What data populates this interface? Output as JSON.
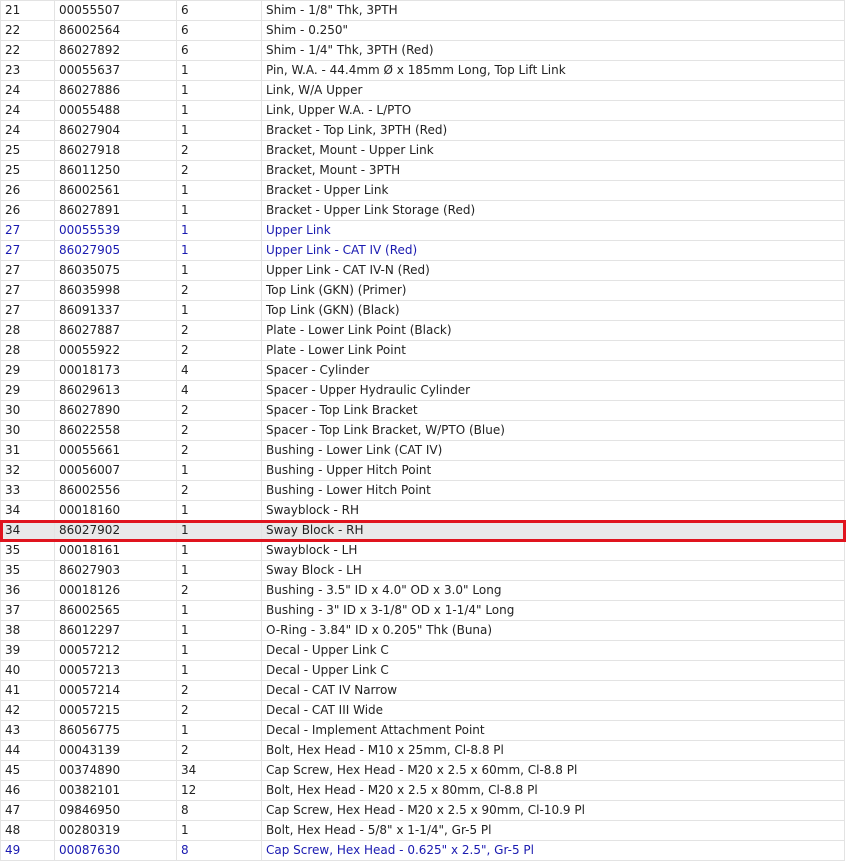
{
  "table": {
    "rows": [
      {
        "item": "21",
        "part": "00055507",
        "qty": "6",
        "desc": "Shim - 1/8\" Thk, 3PTH",
        "link": false,
        "hl": false
      },
      {
        "item": "22",
        "part": "86002564",
        "qty": "6",
        "desc": "Shim - 0.250\"",
        "link": false,
        "hl": false
      },
      {
        "item": "22",
        "part": "86027892",
        "qty": "6",
        "desc": "Shim - 1/4\" Thk, 3PTH (Red)",
        "link": false,
        "hl": false
      },
      {
        "item": "23",
        "part": "00055637",
        "qty": "1",
        "desc": "Pin, W.A. - 44.4mm Ø x 185mm Long, Top Lift Link",
        "link": false,
        "hl": false
      },
      {
        "item": "24",
        "part": "86027886",
        "qty": "1",
        "desc": "Link, W/A Upper",
        "link": false,
        "hl": false
      },
      {
        "item": "24",
        "part": "00055488",
        "qty": "1",
        "desc": "Link, Upper W.A. - L/PTO",
        "link": false,
        "hl": false
      },
      {
        "item": "24",
        "part": "86027904",
        "qty": "1",
        "desc": "Bracket - Top Link, 3PTH (Red)",
        "link": false,
        "hl": false
      },
      {
        "item": "25",
        "part": "86027918",
        "qty": "2",
        "desc": "Bracket, Mount - Upper Link",
        "link": false,
        "hl": false
      },
      {
        "item": "25",
        "part": "86011250",
        "qty": "2",
        "desc": "Bracket, Mount - 3PTH",
        "link": false,
        "hl": false
      },
      {
        "item": "26",
        "part": "86002561",
        "qty": "1",
        "desc": "Bracket - Upper Link",
        "link": false,
        "hl": false
      },
      {
        "item": "26",
        "part": "86027891",
        "qty": "1",
        "desc": "Bracket - Upper Link Storage (Red)",
        "link": false,
        "hl": false
      },
      {
        "item": "27",
        "part": "00055539",
        "qty": "1",
        "desc": "Upper Link",
        "link": true,
        "hl": false
      },
      {
        "item": "27",
        "part": "86027905",
        "qty": "1",
        "desc": "Upper Link - CAT IV (Red)",
        "link": true,
        "hl": false
      },
      {
        "item": "27",
        "part": "86035075",
        "qty": "1",
        "desc": "Upper Link - CAT IV-N (Red)",
        "link": false,
        "hl": false
      },
      {
        "item": "27",
        "part": "86035998",
        "qty": "2",
        "desc": "Top Link (GKN) (Primer)",
        "link": false,
        "hl": false
      },
      {
        "item": "27",
        "part": "86091337",
        "qty": "1",
        "desc": "Top Link (GKN) (Black)",
        "link": false,
        "hl": false
      },
      {
        "item": "28",
        "part": "86027887",
        "qty": "2",
        "desc": "Plate - Lower Link Point (Black)",
        "link": false,
        "hl": false
      },
      {
        "item": "28",
        "part": "00055922",
        "qty": "2",
        "desc": "Plate - Lower Link Point",
        "link": false,
        "hl": false
      },
      {
        "item": "29",
        "part": "00018173",
        "qty": "4",
        "desc": "Spacer - Cylinder",
        "link": false,
        "hl": false
      },
      {
        "item": "29",
        "part": "86029613",
        "qty": "4",
        "desc": "Spacer - Upper Hydraulic Cylinder",
        "link": false,
        "hl": false
      },
      {
        "item": "30",
        "part": "86027890",
        "qty": "2",
        "desc": "Spacer - Top Link Bracket",
        "link": false,
        "hl": false
      },
      {
        "item": "30",
        "part": "86022558",
        "qty": "2",
        "desc": "Spacer - Top Link Bracket, W/PTO (Blue)",
        "link": false,
        "hl": false
      },
      {
        "item": "31",
        "part": "00055661",
        "qty": "2",
        "desc": "Bushing - Lower Link (CAT IV)",
        "link": false,
        "hl": false
      },
      {
        "item": "32",
        "part": "00056007",
        "qty": "1",
        "desc": "Bushing - Upper Hitch Point",
        "link": false,
        "hl": false
      },
      {
        "item": "33",
        "part": "86002556",
        "qty": "2",
        "desc": "Bushing - Lower Hitch Point",
        "link": false,
        "hl": false
      },
      {
        "item": "34",
        "part": "00018160",
        "qty": "1",
        "desc": "Swayblock - RH",
        "link": false,
        "hl": false
      },
      {
        "item": "34",
        "part": "86027902",
        "qty": "1",
        "desc": "Sway Block - RH",
        "link": false,
        "hl": true
      },
      {
        "item": "35",
        "part": "00018161",
        "qty": "1",
        "desc": "Swayblock - LH",
        "link": false,
        "hl": false
      },
      {
        "item": "35",
        "part": "86027903",
        "qty": "1",
        "desc": "Sway Block - LH",
        "link": false,
        "hl": false
      },
      {
        "item": "36",
        "part": "00018126",
        "qty": "2",
        "desc": "Bushing - 3.5\" ID x 4.0\" OD x 3.0\" Long",
        "link": false,
        "hl": false
      },
      {
        "item": "37",
        "part": "86002565",
        "qty": "1",
        "desc": "Bushing - 3\" ID x 3-1/8\" OD x 1-1/4\" Long",
        "link": false,
        "hl": false
      },
      {
        "item": "38",
        "part": "86012297",
        "qty": "1",
        "desc": "O-Ring - 3.84\" ID x 0.205\" Thk (Buna)",
        "link": false,
        "hl": false
      },
      {
        "item": "39",
        "part": "00057212",
        "qty": "1",
        "desc": "Decal - Upper Link C",
        "link": false,
        "hl": false
      },
      {
        "item": "40",
        "part": "00057213",
        "qty": "1",
        "desc": "Decal - Upper Link C",
        "link": false,
        "hl": false
      },
      {
        "item": "41",
        "part": "00057214",
        "qty": "2",
        "desc": "Decal - CAT IV Narrow",
        "link": false,
        "hl": false
      },
      {
        "item": "42",
        "part": "00057215",
        "qty": "2",
        "desc": "Decal - CAT III Wide",
        "link": false,
        "hl": false
      },
      {
        "item": "43",
        "part": "86056775",
        "qty": "1",
        "desc": "Decal - Implement Attachment Point",
        "link": false,
        "hl": false
      },
      {
        "item": "44",
        "part": "00043139",
        "qty": "2",
        "desc": "Bolt, Hex Head - M10 x 25mm, Cl-8.8 Pl",
        "link": false,
        "hl": false
      },
      {
        "item": "45",
        "part": "00374890",
        "qty": "34",
        "desc": "Cap Screw, Hex Head - M20 x 2.5 x 60mm, Cl-8.8 Pl",
        "link": false,
        "hl": false
      },
      {
        "item": "46",
        "part": "00382101",
        "qty": "12",
        "desc": "Bolt, Hex Head - M20 x 2.5 x 80mm, Cl-8.8 Pl",
        "link": false,
        "hl": false
      },
      {
        "item": "47",
        "part": "09846950",
        "qty": "8",
        "desc": "Cap Screw, Hex Head - M20 x 2.5 x 90mm, Cl-10.9 Pl",
        "link": false,
        "hl": false
      },
      {
        "item": "48",
        "part": "00280319",
        "qty": "1",
        "desc": "Bolt, Hex Head - 5/8\" x 1-1/4\", Gr-5 Pl",
        "link": false,
        "hl": false
      },
      {
        "item": "49",
        "part": "00087630",
        "qty": "8",
        "desc": "Cap Screw, Hex Head - 0.625\" x 2.5\", Gr-5 Pl",
        "link": true,
        "hl": false
      }
    ]
  },
  "colors": {
    "link": "#1a1ab0",
    "highlight_border": "#e0141e",
    "highlight_bg": "#e9e9e9",
    "grid": "#e3e3e3"
  }
}
